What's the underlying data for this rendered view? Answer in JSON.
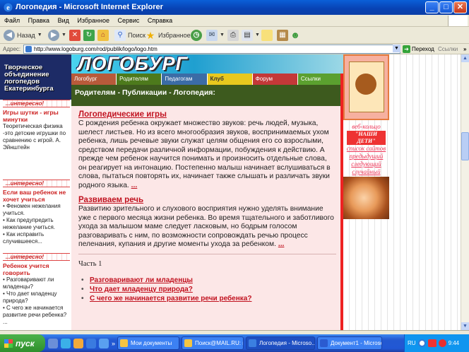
{
  "window": {
    "title": "Логопедия - Microsoft Internet Explorer",
    "min": "_",
    "max": "□",
    "close": "✕"
  },
  "menu": [
    "Файл",
    "Правка",
    "Вид",
    "Избранное",
    "Сервис",
    "Справка"
  ],
  "toolbar": {
    "back": "Назад",
    "search": "Поиск",
    "favorites": "Избранное"
  },
  "address": {
    "label": "Адрес:",
    "url": "http://www.logoburg.com/rod/publik/logo/logo.htm",
    "go": "Переход",
    "links": "Ссылки",
    "more": "»"
  },
  "site": {
    "left_header": [
      "Творческое",
      "объединение",
      "логопедов",
      "Екатеринбурга"
    ],
    "logo": "ЛОГОБУРГ",
    "nav": [
      {
        "label": "Логобург",
        "color": "#b85a3a"
      },
      {
        "label": "Родителям",
        "color": "#4d7a1c"
      },
      {
        "label": "Педагогам",
        "color": "#3b6ca6"
      },
      {
        "label": "Клуб",
        "color": "#e8c81e",
        "text": "#333"
      },
      {
        "label": "Форум",
        "color": "#c43838"
      },
      {
        "label": "Ссылки",
        "color": "#5ba02f"
      }
    ],
    "crumb": "Родителям - Публикации - Логопедия:",
    "left_boxes": [
      {
        "banner": "...интересно!",
        "title": "Игры шутки - игры минутки",
        "text": "Теоретическая физика -это детские игрушки по сравнению с игрой. А. Эйнштейн"
      },
      {
        "banner": "...интересно!",
        "title": "Если ваш ребенок не хочет учиться",
        "items": [
          "• Феномен нежелания учиться.",
          "• Как предупредить нежелание учиться.",
          "• Как исправить случившееся..."
        ]
      },
      {
        "banner": "...интересно!",
        "title": "Ребенок учится говорить",
        "items": [
          "• Разговаривают ли младенцы?",
          "• Что дает младенцу природа?",
          "• С чего же начинается развитие речи ребенка? ..."
        ]
      }
    ],
    "articles": [
      {
        "title": "Логопедические игры",
        "body": "С рождения ребенка окружает множество звуков: речь людей, музыка, шелест листьев. Но из всего многообразия звуков, воспринимаемых ухом ребенка, лишь речевые звуки служат целям общения его со взрослыми, средством передачи различной информации, побуждения к действию. А прежде чем ребенок научится понимать и произносить отдельные слова, он реагирует на интонацию. Постепенно малыш начинает вслушиваться в слова, пытаться повторять их, начинает также слышать и различать звуки родного языка.",
        "more": "..."
      },
      {
        "title": "Развиваем речь",
        "body": "Развитию зрительного и слухового восприятия нужно уделять внимание уже с первого месяца жизни ребенка. Во время тщательного и заботливого ухода за малышом маме следует ласковым, но бодрым голосом разговаривать с ним, по возможности сопровождать речью процесс пеленания, купания и другие моменты ухода за ребенком.",
        "more": "..."
      }
    ],
    "part": "Часть 1",
    "bullets": [
      "Разговаривают ли младенцы",
      "Что дает младенцу природа?",
      "С чего же начинается развитие речи ребенка?"
    ],
    "right": {
      "ring": "веб-кольцо",
      "nash": "\"НАШИ ДЕТИ\"",
      "lines": [
        "список сайтов",
        "предыдущий",
        "следующий",
        "случайный"
      ]
    }
  },
  "taskbar": {
    "start": "пуск",
    "items": [
      {
        "label": "Мои документы",
        "color": "#f5c542"
      },
      {
        "label": "Поиск@MAIL.RU: по...",
        "color": "#f5c542"
      },
      {
        "label": "Логопедия - Microso...",
        "color": "#3b7fe0"
      },
      {
        "label": "Документ1 - Microso...",
        "color": "#2b5bd0"
      }
    ],
    "lang": "RU",
    "time": "9:44"
  }
}
